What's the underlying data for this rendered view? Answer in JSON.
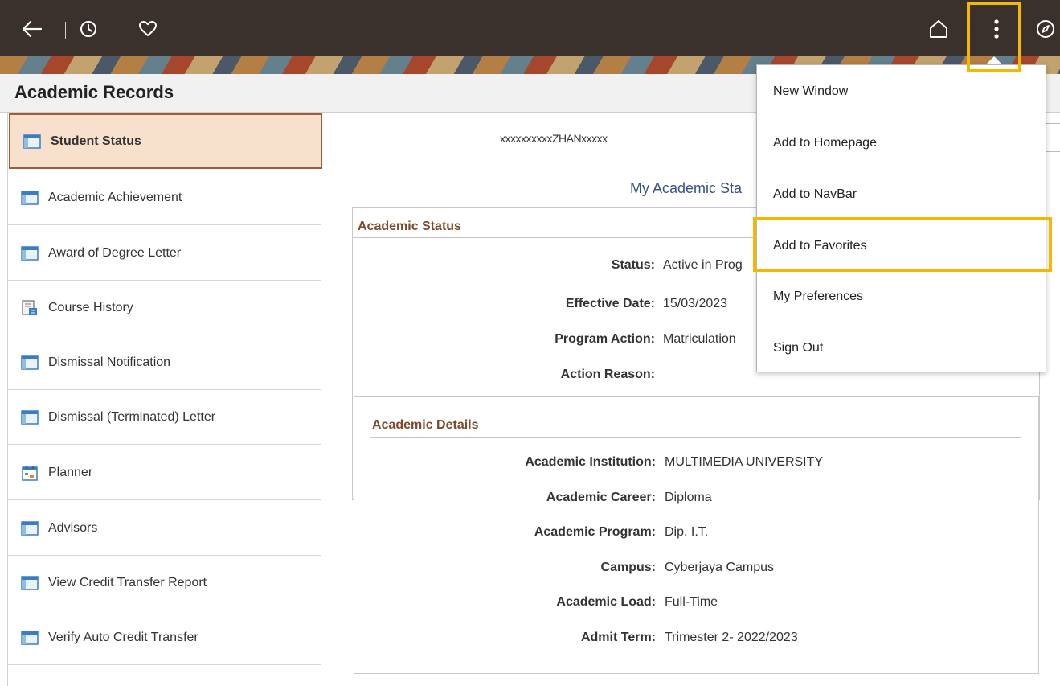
{
  "titlebar": {
    "title": "Academic Records"
  },
  "banner": {
    "icons": [
      "back-arrow-icon",
      "history-icon",
      "heart-icon",
      "home-icon",
      "more-vertical-icon",
      "compass-icon"
    ]
  },
  "sidebar": {
    "items": [
      {
        "label": "Student Status",
        "icon": "page-icon",
        "active": true
      },
      {
        "label": "Academic Achievement",
        "icon": "page-icon"
      },
      {
        "label": "Award of Degree Letter",
        "icon": "page-icon"
      },
      {
        "label": "Course History",
        "icon": "report-icon"
      },
      {
        "label": "Dismissal Notification",
        "icon": "page-icon"
      },
      {
        "label": "Dismissal (Terminated) Letter",
        "icon": "page-icon"
      },
      {
        "label": "Planner",
        "icon": "calendar-icon"
      },
      {
        "label": "Advisors",
        "icon": "page-icon"
      },
      {
        "label": "View Credit Transfer Report",
        "icon": "page-icon"
      },
      {
        "label": "Verify Auto Credit Transfer",
        "icon": "page-icon"
      }
    ]
  },
  "main": {
    "student_name": "xxxxxxxxxxZHANxxxxx",
    "heading": "My Academic Sta",
    "academic_status": {
      "title": "Academic Status",
      "fields": [
        {
          "label": "Status:",
          "value": "Active in Prog"
        },
        {
          "label": "Effective Date:",
          "value": "15/03/2023"
        },
        {
          "label": "Program Action:",
          "value": "Matriculation"
        },
        {
          "label": "Action Reason:",
          "value": ""
        }
      ]
    },
    "academic_details": {
      "title": "Academic Details",
      "fields": [
        {
          "label": "Academic Institution:",
          "value": "MULTIMEDIA UNIVERSITY"
        },
        {
          "label": "Academic Career:",
          "value": "Diploma"
        },
        {
          "label": "Academic Program:",
          "value": "Dip. I.T."
        },
        {
          "label": "Campus:",
          "value": "Cyberjaya Campus"
        },
        {
          "label": "Academic Load:",
          "value": "Full-Time"
        },
        {
          "label": "Admit Term:",
          "value": "Trimester 2- 2022/2023"
        }
      ]
    }
  },
  "menu": {
    "items": [
      {
        "label": "New Window"
      },
      {
        "label": "Add to Homepage"
      },
      {
        "label": "Add to NavBar"
      },
      {
        "label": "Add to Favorites",
        "highlighted": true
      },
      {
        "label": "My Preferences"
      },
      {
        "label": "Sign Out"
      }
    ]
  },
  "colors": {
    "highlight": "#f5b800",
    "active_bg": "#f7e1cd",
    "active_border": "#a45c36",
    "section_title": "#7a4a2a",
    "heading": "#35508c"
  }
}
